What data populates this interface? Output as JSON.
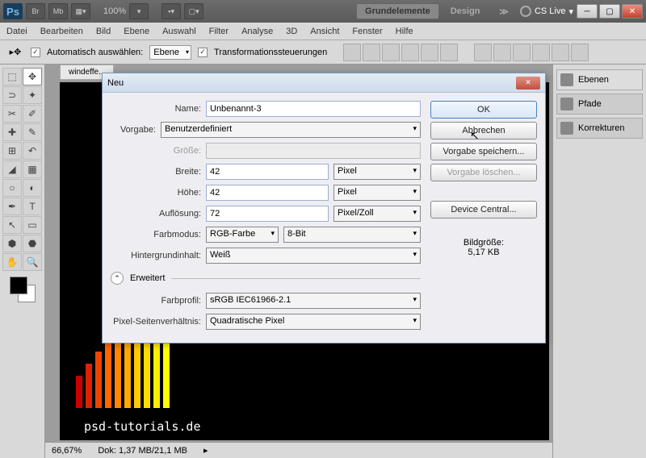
{
  "topbar": {
    "ps": "Ps",
    "zoom": "100%",
    "pill1": "Grundelemente",
    "pill2": "Design",
    "cslive": "CS Live"
  },
  "menu": [
    "Datei",
    "Bearbeiten",
    "Bild",
    "Ebene",
    "Auswahl",
    "Filter",
    "Analyse",
    "3D",
    "Ansicht",
    "Fenster",
    "Hilfe"
  ],
  "optbar": {
    "chk1": "Automatisch auswählen:",
    "dd1": "Ebene",
    "chk2": "Transformationssteuerungen"
  },
  "tab": "windeffe...",
  "watermark": "psd-tutorials.de",
  "status": {
    "zoom": "66,67%",
    "doc": "Dok: 1,37 MB/21,1 MB"
  },
  "panels": {
    "p1": "Ebenen",
    "p2": "Pfade",
    "p3": "Korrekturen"
  },
  "dialog": {
    "title": "Neu",
    "labels": {
      "name": "Name:",
      "vorgabe": "Vorgabe:",
      "groesse": "Größe:",
      "breite": "Breite:",
      "hoehe": "Höhe:",
      "aufl": "Auflösung:",
      "farb": "Farbmodus:",
      "hinter": "Hintergrundinhalt:",
      "erw": "Erweitert",
      "profil": "Farbprofil:",
      "pixelsv": "Pixel-Seitenverhältnis:",
      "bildg": "Bildgröße:",
      "size": "5,17 KB"
    },
    "values": {
      "name": "Unbenannt-3",
      "vorgabe": "Benutzerdefiniert",
      "breite": "42",
      "hoehe": "42",
      "aufl": "72",
      "profil": "sRGB IEC61966-2.1",
      "pixelsv": "Quadratische Pixel"
    },
    "units": {
      "px": "Pixel",
      "pz": "Pixel/Zoll",
      "rgb": "RGB-Farbe",
      "bit": "8-Bit",
      "weiss": "Weiß"
    },
    "buttons": {
      "ok": "OK",
      "cancel": "Abbrechen",
      "save": "Vorgabe speichern...",
      "del": "Vorgabe löschen...",
      "dc": "Device Central..."
    }
  }
}
